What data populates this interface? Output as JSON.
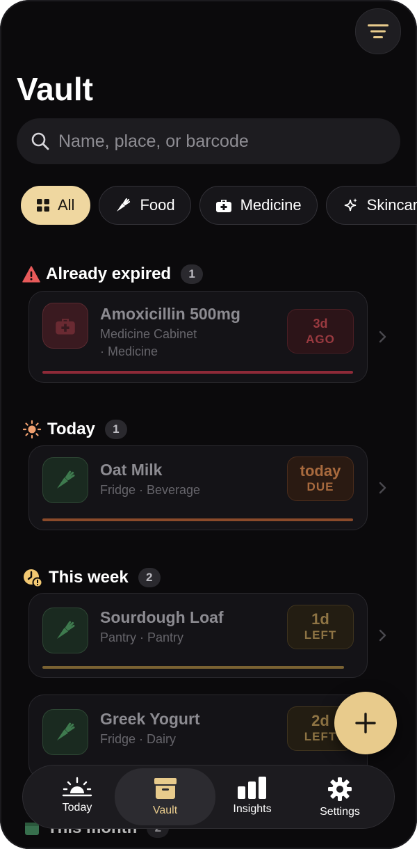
{
  "app": {
    "title": "Vault"
  },
  "search": {
    "placeholder": "Name, place, or barcode"
  },
  "filters": [
    {
      "label": "All",
      "icon": "grid-icon",
      "active": true
    },
    {
      "label": "Food",
      "icon": "carrot-icon",
      "active": false
    },
    {
      "label": "Medicine",
      "icon": "medkit-icon",
      "active": false
    },
    {
      "label": "Skincare",
      "icon": "sparkle-icon",
      "active": false
    }
  ],
  "sections": {
    "expired": {
      "label": "Already expired",
      "count": "1",
      "icon": "warning-icon",
      "items": [
        {
          "name": "Amoxicillin 500mg",
          "location": "Medicine Cabinet",
          "category": "· Medicine",
          "badge_top": "3d",
          "badge_bottom": "AGO",
          "icon": "medkit-icon",
          "status_color": "#8e2a38"
        }
      ]
    },
    "today": {
      "label": "Today",
      "count": "1",
      "icon": "sun-icon",
      "items": [
        {
          "name": "Oat Milk",
          "meta": "Fridge · Beverage",
          "badge_top": "today",
          "badge_bottom": "DUE",
          "icon": "carrot-icon",
          "status_color": "#8a4a2a"
        }
      ]
    },
    "week": {
      "label": "This week",
      "count": "2",
      "icon": "clock-alert-icon",
      "items": [
        {
          "name": "Sourdough Loaf",
          "meta": "Pantry · Pantry",
          "badge_top": "1d",
          "badge_bottom": "LEFT",
          "icon": "carrot-icon",
          "status_color": "#7a6232"
        },
        {
          "name": "Greek Yogurt",
          "meta": "Fridge · Dairy",
          "badge_top": "2d",
          "badge_bottom": "LEFT",
          "icon": "carrot-icon",
          "status_color": "#7a6232"
        }
      ]
    },
    "month": {
      "label": "This month",
      "count": "2",
      "icon": "calendar-icon"
    }
  },
  "tabs": [
    {
      "label": "Today",
      "icon": "sunrise-icon",
      "active": false
    },
    {
      "label": "Vault",
      "icon": "archive-icon",
      "active": true
    },
    {
      "label": "Insights",
      "icon": "bar-chart-icon",
      "active": false
    },
    {
      "label": "Settings",
      "icon": "gear-icon",
      "active": false
    }
  ],
  "colors": {
    "accent": "#e8cb8c",
    "background": "#0b0a0c",
    "expired": "#e85a5a",
    "today": "#f0a070",
    "week": "#f2c872"
  }
}
